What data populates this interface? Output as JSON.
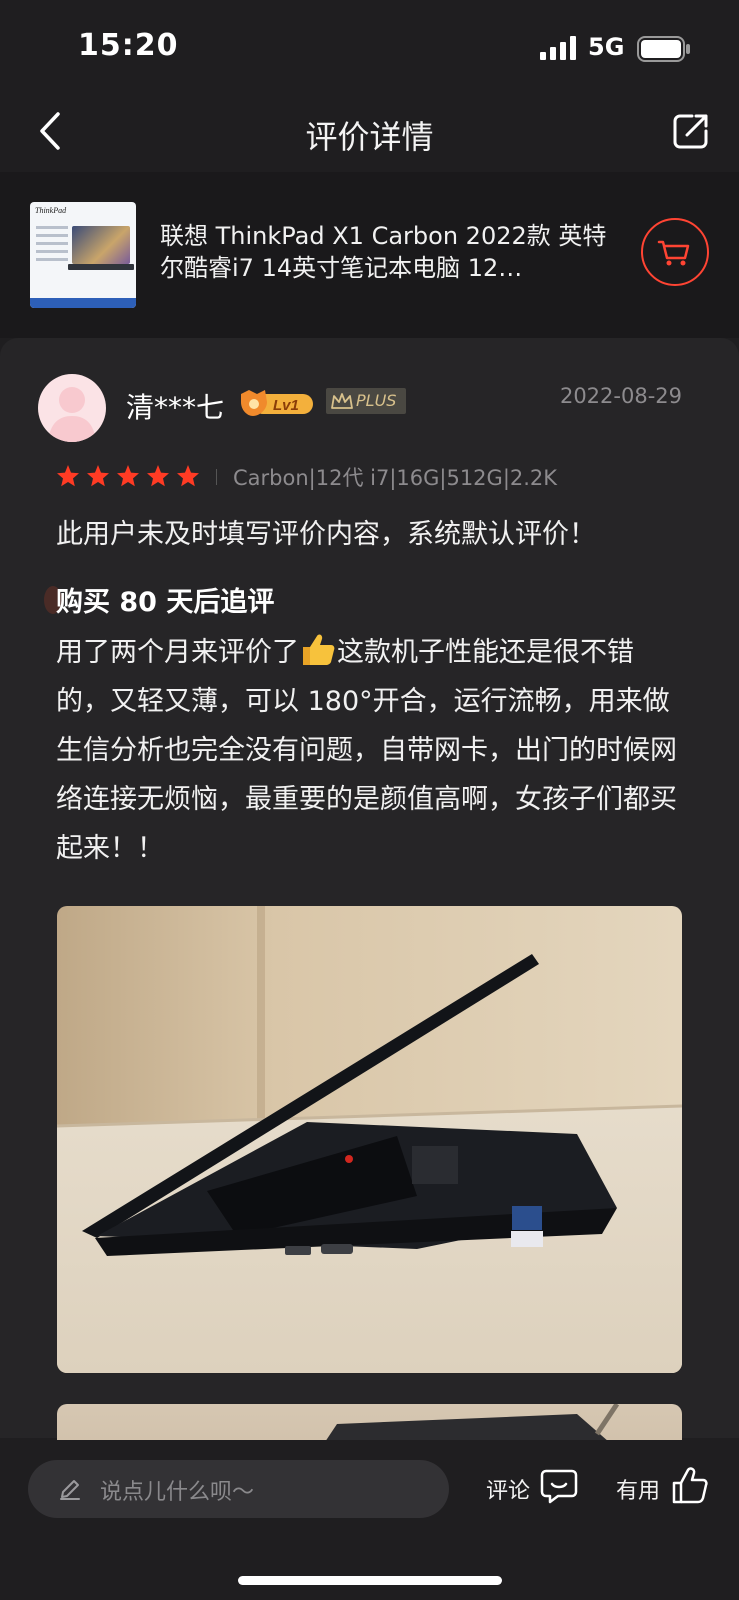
{
  "status_bar": {
    "time": "15:20",
    "network": "5G"
  },
  "nav": {
    "title": "评价详情",
    "back_icon": "chevron-left-icon",
    "share_icon": "share-icon"
  },
  "product": {
    "title": "联想 ThinkPad X1 Carbon 2022款 英特尔酷睿i7 14英寸笔记本电脑 12…",
    "thumbnail_brand": "ThinkPad",
    "cart_icon": "cart-icon",
    "accent_color": "#ff4433"
  },
  "review": {
    "username": "清***七",
    "level_badge": "Lv1",
    "plus_badge": "PLUS",
    "date": "2022-08-29",
    "rating": 5,
    "spec": "Carbon|12代 i7|16G|512G|2.2K",
    "content": "此用户未及时填写评价内容，系统默认评价！",
    "followup_title": "购买 80 天后追评",
    "followup_part1": "用了两个月来评价了",
    "followup_part2": "这款机子性能还是很不错的，又轻又薄，可以 180°开合，运行流畅，用来做生信分析也完全没有问题，自带网卡，出门的时候网络连接无烦恼，最重要的是颜值高啊，女孩子们都买起来！！",
    "star_color": "#ff3b24"
  },
  "bottom": {
    "input_placeholder": "说点儿什么呗～",
    "comment_label": "评论",
    "useful_label": "有用"
  }
}
